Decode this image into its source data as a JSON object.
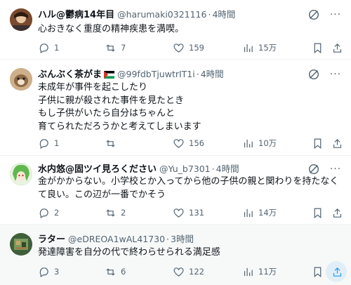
{
  "tweets": [
    {
      "name": "ハル@鬱病14年目",
      "handle": "@harumaki0321116",
      "time": "4時間",
      "text": "心おきなく重度の精神疾患を満喫。",
      "replies": "1",
      "reposts": "7",
      "likes": "159",
      "views": "15万",
      "flag": false,
      "avatar_color": "#6b3d26"
    },
    {
      "name": "ぶんぶく茶がま",
      "handle": "@99fdbTjuwtrIT1i",
      "time": "4時間",
      "text": "未成年が事件を起こしたり\n子供に親が殺された事件を見たとき\nもし子供がいたら自分はちゃんと\n育てられただろうかと考えてしまいます",
      "replies": "1",
      "reposts": "",
      "likes": "156",
      "views": "10万",
      "flag": true,
      "avatar_color": "#b79970"
    },
    {
      "name": "水内悠@固ツイ見ろください",
      "handle": "@Yu_b7301",
      "time": "4時間",
      "text": "金がかからない。小学校とか入ってから他の子供の親と関わりを持たなくて良い。この辺が一番でかそう",
      "replies": "2",
      "reposts": "2",
      "likes": "131",
      "views": "14万",
      "flag": false,
      "avatar_color": "#6fb86a"
    },
    {
      "name": "ラター",
      "handle": "@eDREOA1wAL41730",
      "time": "3時間",
      "text": "発達障害を自分の代で終わらせられる満足感",
      "replies": "3",
      "reposts": "6",
      "likes": "122",
      "views": "11万",
      "flag": false,
      "avatar_color": "#3d5a3a"
    }
  ],
  "icons": {
    "reply": "reply-icon",
    "repost": "repost-icon",
    "like": "heart-icon",
    "views": "views-chart-icon",
    "bookmark": "bookmark-icon",
    "share": "share-icon",
    "grok": "grok-icon",
    "more": "more-icon"
  },
  "colors": {
    "accent": "#1d9bf0",
    "secondary_text": "#536471",
    "border": "#eff3f4"
  }
}
